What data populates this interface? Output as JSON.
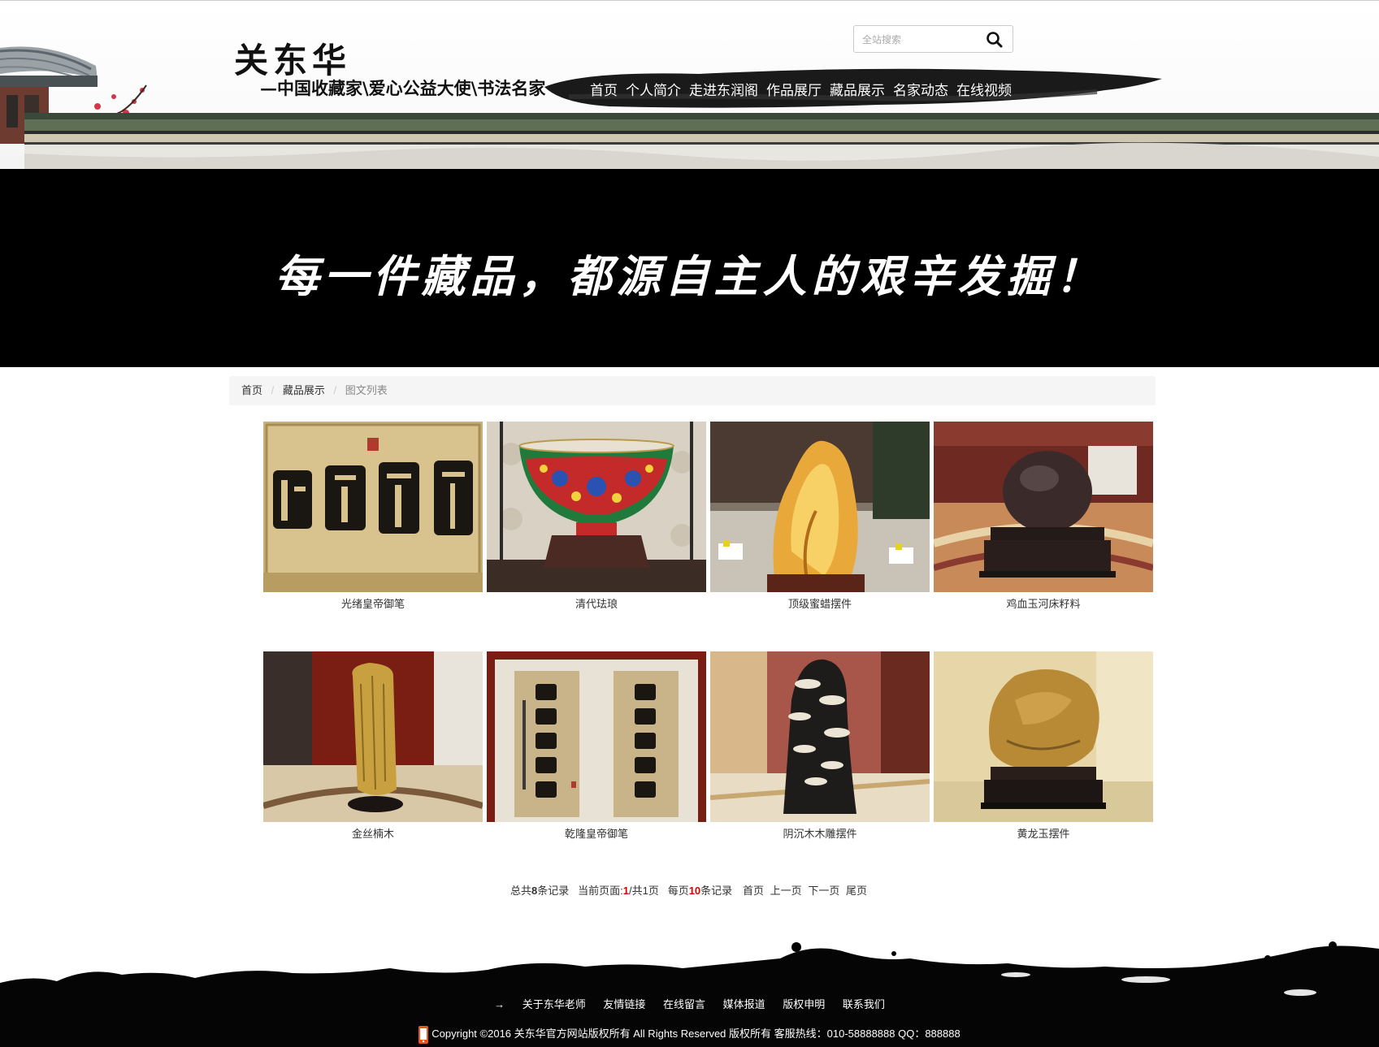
{
  "header": {
    "logo_title": "关东华",
    "logo_subtitle": "—中国收藏家\\爱心公益大使\\书法名家",
    "search_placeholder": "全站搜索",
    "nav": [
      "首页",
      "个人简介",
      "走进东润阁",
      "作品展厅",
      "藏品展示",
      "名家动态",
      "在线视频"
    ]
  },
  "banner": {
    "slogan": "每一件藏品，都源自主人的艰辛发掘！"
  },
  "breadcrumb": {
    "home": "首页",
    "section": "藏品展示",
    "current": "图文列表"
  },
  "items": [
    {
      "title": "光绪皇帝御笔",
      "image": "calligraphy-plaque"
    },
    {
      "title": "清代珐琅",
      "image": "enamel-bowl"
    },
    {
      "title": "顶级蜜蜡摆件",
      "image": "amber-carving"
    },
    {
      "title": "鸡血玉河床籽料",
      "image": "jade-stone"
    },
    {
      "title": "金丝楠木",
      "image": "nanmu-log"
    },
    {
      "title": "乾隆皇帝御笔",
      "image": "calligraphy-couplet"
    },
    {
      "title": "阴沉木木雕摆件",
      "image": "wood-carving"
    },
    {
      "title": "黄龙玉摆件",
      "image": "yellow-jade"
    }
  ],
  "pager": {
    "prefix_total": "总共",
    "total": "8",
    "suffix_total": "条记录",
    "current_label": "当前页面:",
    "current": "1",
    "of_pages": "/共1页",
    "per_label": "每页",
    "per": "10",
    "per_suffix": "条记录",
    "first": "首页",
    "prev": "上一页",
    "next": "下一页",
    "last": "尾页"
  },
  "footer": {
    "arrow": "→",
    "links": [
      "关于东华老师",
      "友情链接",
      "在线留言",
      "媒体报道",
      "版权申明",
      "联系我们"
    ],
    "copyright": "Copyright ©2016 关东华官方网站版权所有 All Rights Reserved 版权所有 客服热线：010-58888888 QQ：888888"
  }
}
